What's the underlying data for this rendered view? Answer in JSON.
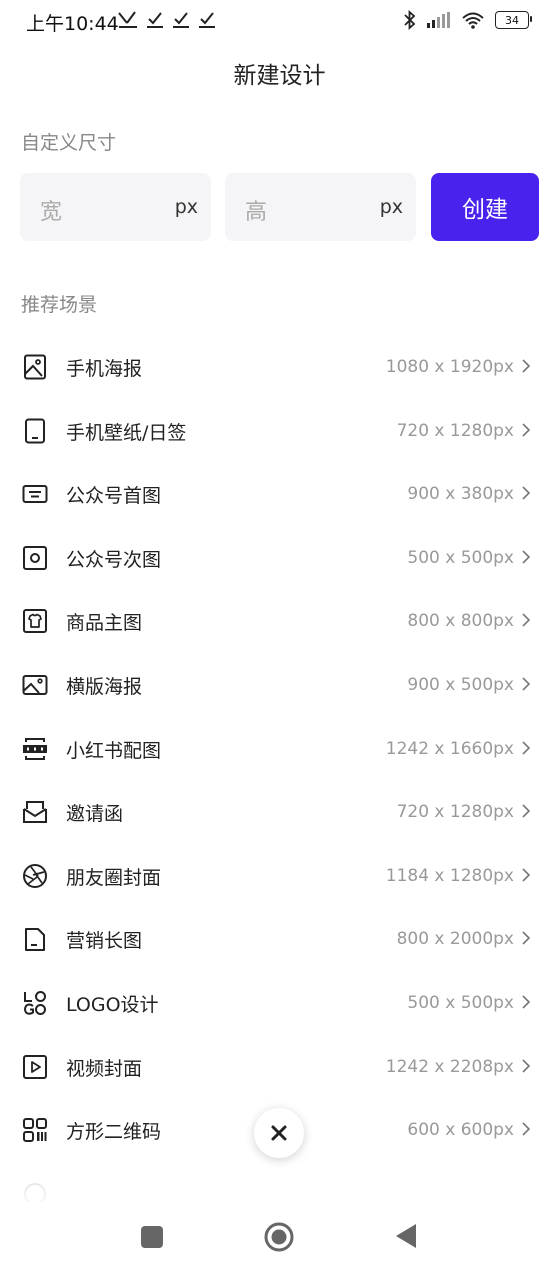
{
  "status": {
    "time": "上午10:44",
    "left_icons": "✓ ✓ ✓",
    "battery": "34"
  },
  "header": {
    "title": "新建设计"
  },
  "custom_size": {
    "label": "自定义尺寸",
    "width_placeholder": "宽",
    "height_placeholder": "高",
    "unit": "px",
    "create_label": "创建",
    "accent": "#4a22ee"
  },
  "scenes": {
    "label": "推荐场景",
    "items": [
      {
        "name": "手机海报",
        "size": "1080 x 1920px",
        "icon": "image-portrait-icon"
      },
      {
        "name": "手机壁纸/日签",
        "size": "720 x 1280px",
        "icon": "phone-icon"
      },
      {
        "name": "公众号首图",
        "size": "900 x 380px",
        "icon": "banner-icon"
      },
      {
        "name": "公众号次图",
        "size": "500 x 500px",
        "icon": "square-circle-icon"
      },
      {
        "name": "商品主图",
        "size": "800 x 800px",
        "icon": "tshirt-icon"
      },
      {
        "name": "横版海报",
        "size": "900 x 500px",
        "icon": "image-landscape-icon"
      },
      {
        "name": "小红书配图",
        "size": "1242 x 1660px",
        "icon": "xiaohongshu-icon"
      },
      {
        "name": "邀请函",
        "size": "720 x 1280px",
        "icon": "envelope-icon"
      },
      {
        "name": "朋友圈封面",
        "size": "1184 x 1280px",
        "icon": "aperture-icon"
      },
      {
        "name": "营销长图",
        "size": "800 x 2000px",
        "icon": "document-icon"
      },
      {
        "name": "LOGO设计",
        "size": "500 x 500px",
        "icon": "logo-icon"
      },
      {
        "name": "视频封面",
        "size": "1242 x 2208px",
        "icon": "play-icon"
      },
      {
        "name": "方形二维码",
        "size": "600 x 600px",
        "icon": "qrcode-icon"
      }
    ]
  }
}
